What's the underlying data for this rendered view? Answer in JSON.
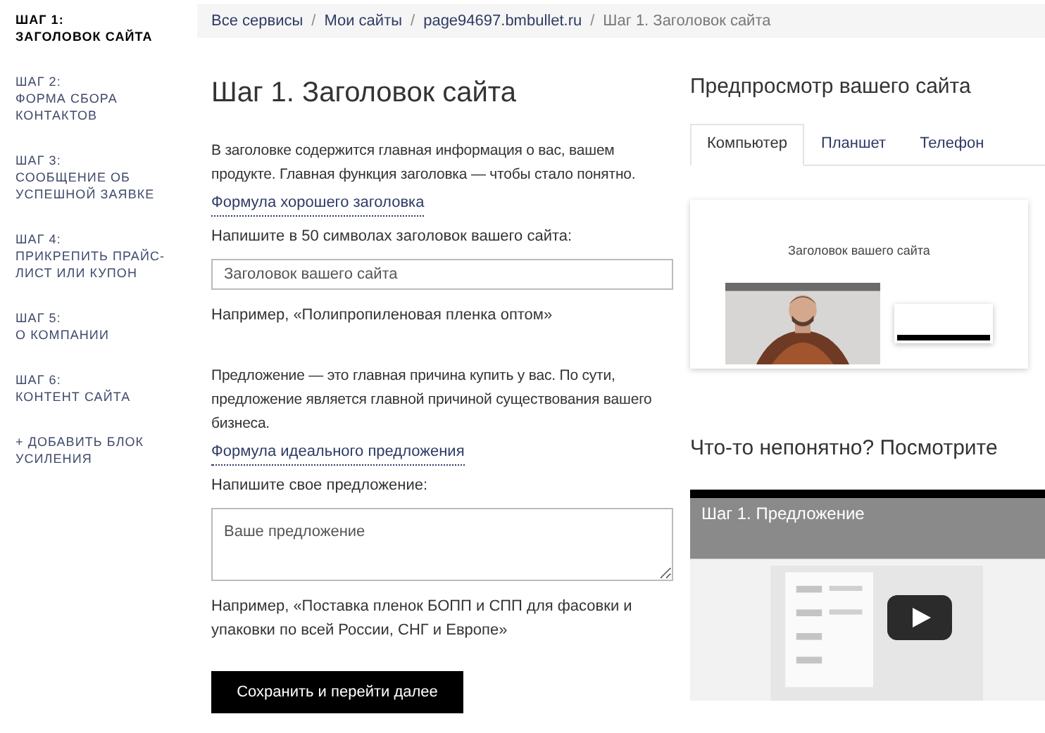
{
  "sidebar": {
    "items": [
      {
        "lines": [
          "ШАГ 1:",
          "ЗАГОЛОВОК САЙТА"
        ],
        "selected": true
      },
      {
        "lines": [
          "ШАГ 2:",
          "ФОРМА СБОРА",
          "КОНТАКТОВ"
        ],
        "selected": false
      },
      {
        "lines": [
          "ШАГ 3:",
          "СООБЩЕНИЕ ОБ",
          "УСПЕШНОЙ ЗАЯВКЕ"
        ],
        "selected": false
      },
      {
        "lines": [
          "ШАГ 4:",
          "ПРИКРЕПИТЬ ПРАЙС-",
          "ЛИСТ ИЛИ КУПОН"
        ],
        "selected": false
      },
      {
        "lines": [
          "ШАГ 5:",
          "О КОМПАНИИ"
        ],
        "selected": false
      },
      {
        "lines": [
          "ШАГ 6:",
          "КОНТЕНТ САЙТА"
        ],
        "selected": false
      },
      {
        "lines": [
          "+ ДОБАВИТЬ БЛОК",
          "УСИЛЕНИЯ"
        ],
        "selected": false
      }
    ]
  },
  "breadcrumbs": [
    "Все сервисы",
    "Мои сайты",
    "page94697.bmbullet.ru",
    "Шаг 1. Заголовок сайта"
  ],
  "breadcrumb_separator": "/",
  "title": "Шаг 1. Заголовок сайта",
  "sections": [
    {
      "text": "В заголовке содержится главная информация о вас, вашем продукте. Главная функция заголовка — чтобы стало понятно.",
      "link": "Формула хорошего заголовка",
      "field_label": "Напишите в 50 символах заголовок вашего сайта:",
      "kind": "input",
      "placeholder": "Заголовок вашего сайта",
      "example": "Например, «Полипропиленовая пленка оптом»"
    },
    {
      "text": "Предложение — это главная причина купить у вас. По сути, предложение является главной причиной существования вашего бизнеса.",
      "link": "Формула идеального предложения",
      "field_label": "Напишите свое предложение:",
      "kind": "textarea",
      "placeholder": "Ваше предложение",
      "example": "Например, «Поставка пленок БОПП и СПП для фасовки и упаковки по всей России, СНГ и Европе»"
    }
  ],
  "save_button": "Сохранить и перейти далее",
  "preview": {
    "title": "Предпросмотр вашего сайта",
    "tabs": [
      {
        "label": "Компьютер",
        "selected": true
      },
      {
        "label": "Планшет",
        "selected": false
      },
      {
        "label": "Телефон",
        "selected": false
      }
    ],
    "site_heading": "Заголовок вашего сайта"
  },
  "help": {
    "title": "Что-то непонятно? Посмотрите",
    "video_title": "Шаг 1. Предложение"
  }
}
